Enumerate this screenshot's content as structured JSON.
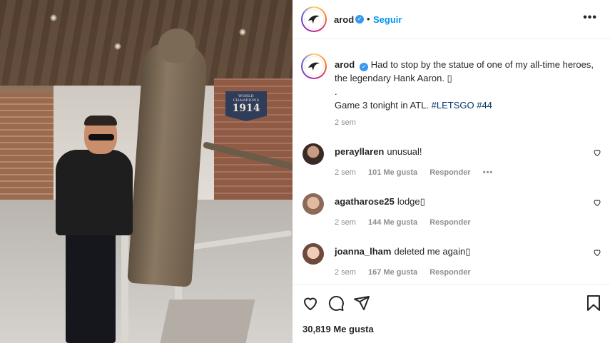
{
  "photo": {
    "banner_small": "WORLD CHAMPIONS",
    "banner_year": "1914"
  },
  "header": {
    "username": "arod",
    "separator": "•",
    "follow_label": "Seguir",
    "more_label": "•••"
  },
  "caption": {
    "username": "arod",
    "text": "Had to stop by the statue of one of my all-time heroes, the legendary Hank Aaron. ▯",
    "dot_line": ".",
    "line2_plain": "Game 3 tonight in ATL. ",
    "hashtag1": "#LETSGO",
    "hashtag2": "#44",
    "time": "2 sem"
  },
  "comments": [
    {
      "username": "perayllaren",
      "text": "unusual!",
      "time": "2 sem",
      "likes": "101 Me gusta",
      "reply": "Responder",
      "more": "•••"
    },
    {
      "username": "agatharose25",
      "text": "lodge▯",
      "time": "2 sem",
      "likes": "144 Me gusta",
      "reply": "Responder"
    },
    {
      "username": "joanna_lham",
      "text": "deleted me again▯",
      "time": "2 sem",
      "likes": "167 Me gusta",
      "reply": "Responder"
    }
  ],
  "footer": {
    "likes": "30,819 Me gusta"
  },
  "colors": {
    "link_blue": "#0095f6",
    "hashtag": "#00376b",
    "verified": "#3897f0",
    "muted": "#8e8e8e"
  },
  "icons": [
    "verified-icon",
    "more-icon",
    "heart-icon",
    "comment-icon",
    "share-icon",
    "bookmark-icon"
  ]
}
